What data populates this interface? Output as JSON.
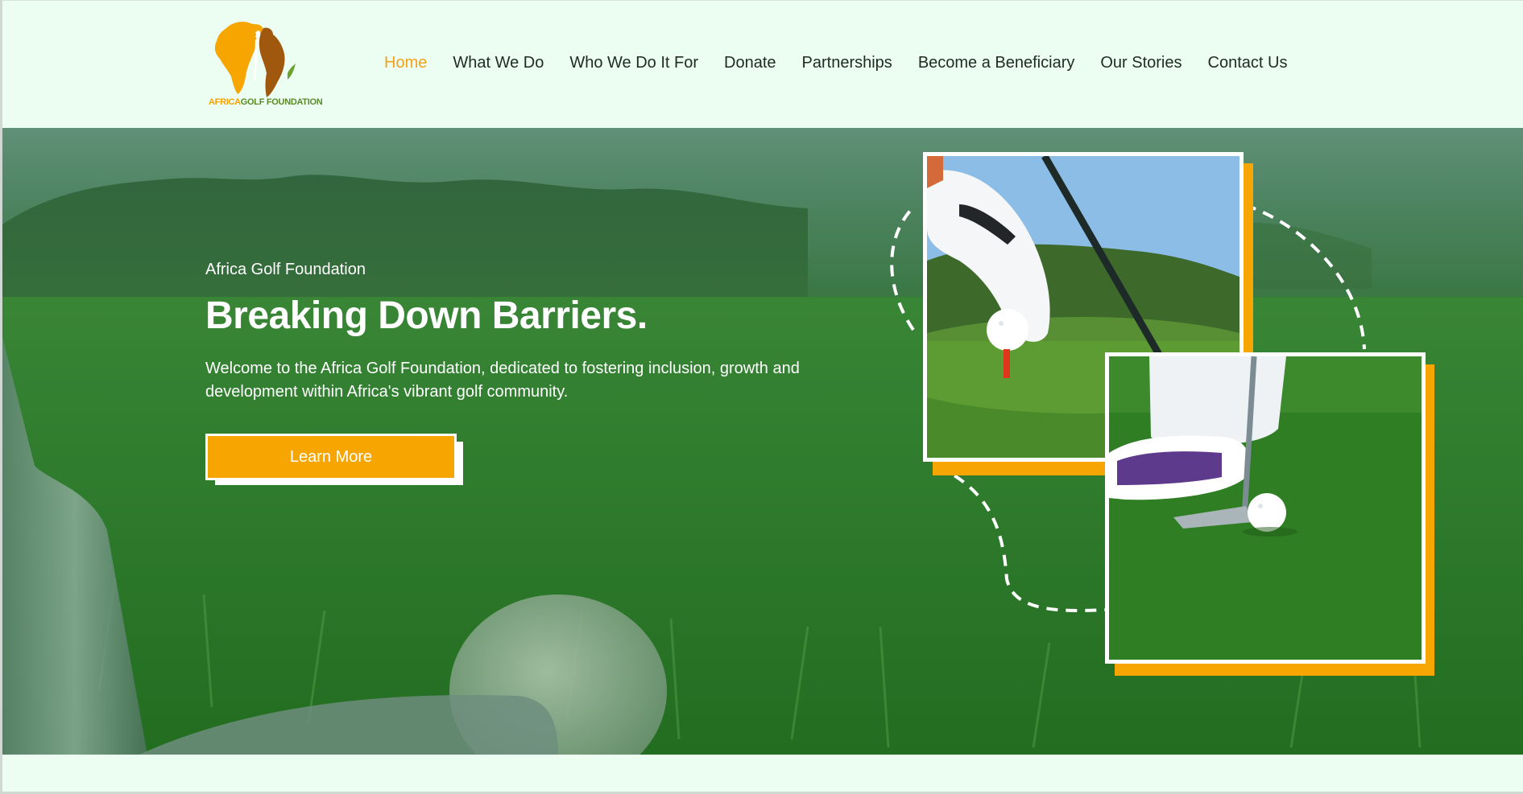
{
  "brand": {
    "logo_text_part1": "AFRICA",
    "logo_text_part2": "GOLF FOUNDATION",
    "accent_color": "#f7a500",
    "logo_green": "#5a8a25",
    "logo_brown": "#a0580e"
  },
  "nav": {
    "items": [
      {
        "label": "Home",
        "active": true
      },
      {
        "label": "What We Do"
      },
      {
        "label": "Who We Do It For"
      },
      {
        "label": "Donate"
      },
      {
        "label": "Partnerships"
      },
      {
        "label": "Become a Beneficiary"
      },
      {
        "label": "Our Stories"
      },
      {
        "label": "Contact Us"
      }
    ]
  },
  "hero": {
    "eyebrow": "Africa Golf Foundation",
    "headline": "Breaking Down Barriers.",
    "lead": "Welcome to the Africa Golf Foundation, dedicated to fostering inclusion, growth and development within Africa's vibrant golf community.",
    "cta_label": "Learn More"
  },
  "icons": {
    "logo": "africa-map-golfer-logo-icon"
  }
}
